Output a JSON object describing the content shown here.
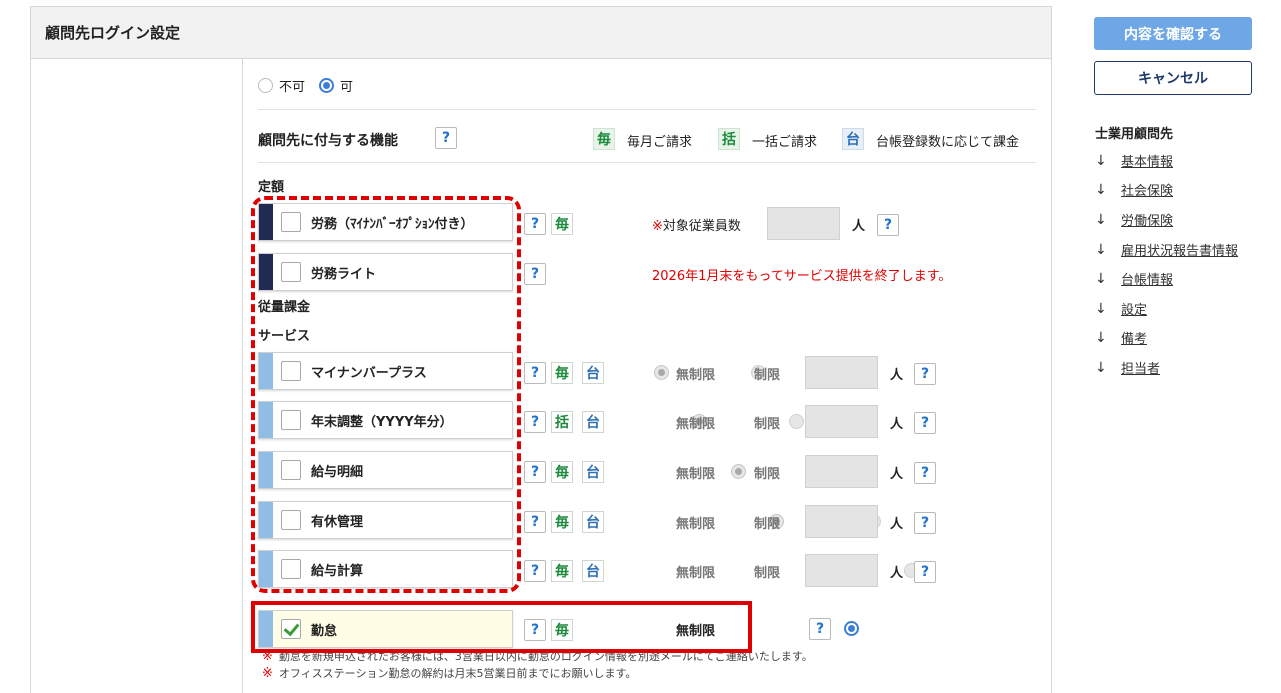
{
  "panel": {
    "title": "顧問先ログイン設定"
  },
  "login": {
    "opt_no": "不可",
    "opt_yes": "可"
  },
  "features": {
    "title": "顧問先に付与する機能",
    "help": "?",
    "legend": [
      {
        "badge": "毎",
        "text": "毎月ご請求"
      },
      {
        "badge": "括",
        "text": "一括ご請求"
      },
      {
        "badge": "台",
        "text": "台帳登録数に応じて課金"
      }
    ]
  },
  "sections": {
    "fixed": "定額",
    "usage_line1": "従量課金",
    "usage_line2": "サービス"
  },
  "services": {
    "roumu": {
      "name": "労務（ﾏｲﾅﾝﾊﾞｰｵﾌﾟｼｮﾝ付き）",
      "badges": [
        "毎"
      ],
      "employee_label": "※対象従業員数",
      "unit": "人"
    },
    "roumu_lite": {
      "name": "労務ライト",
      "notice": "2026年1月末をもってサービス提供を終了します。"
    },
    "items": [
      {
        "name": "マイナンバープラス",
        "badges": [
          "毎",
          "台"
        ]
      },
      {
        "name": "年末調整（YYYY年分）",
        "badges": [
          "括",
          "台"
        ]
      },
      {
        "name": "給与明細",
        "badges": [
          "毎",
          "台"
        ]
      },
      {
        "name": "有休管理",
        "badges": [
          "毎",
          "台"
        ]
      },
      {
        "name": "給与計算",
        "badges": [
          "毎",
          "台"
        ]
      }
    ],
    "unlimited": "無制限",
    "limited": "制限",
    "unit": "人",
    "kintai": {
      "name": "勤怠",
      "badges": [
        "毎"
      ],
      "unlimited": "無制限"
    }
  },
  "notes": [
    "勤怠を新規申込されたお客様には、3営業日以内に勤怠のログイン情報を別途メールにてご連絡いたします。",
    "オフィスステーション勤怠の解約は月末5営業日前までにお願いします。"
  ],
  "note_mark": "※",
  "buttons": {
    "confirm": "内容を確認する",
    "cancel": "キャンセル"
  },
  "nav": {
    "title": "士業用顧問先",
    "items": [
      "基本情報",
      "社会保険",
      "労働保険",
      "雇用状況報告書情報",
      "台帳情報",
      "設定",
      "備考",
      "担当者"
    ],
    "arrow": "↓"
  },
  "colors": {
    "accent": "#3a7fd5",
    "highlight_red": "#e00000",
    "dark_stripe": "#1f2b52",
    "light_stripe": "#90bde6"
  }
}
